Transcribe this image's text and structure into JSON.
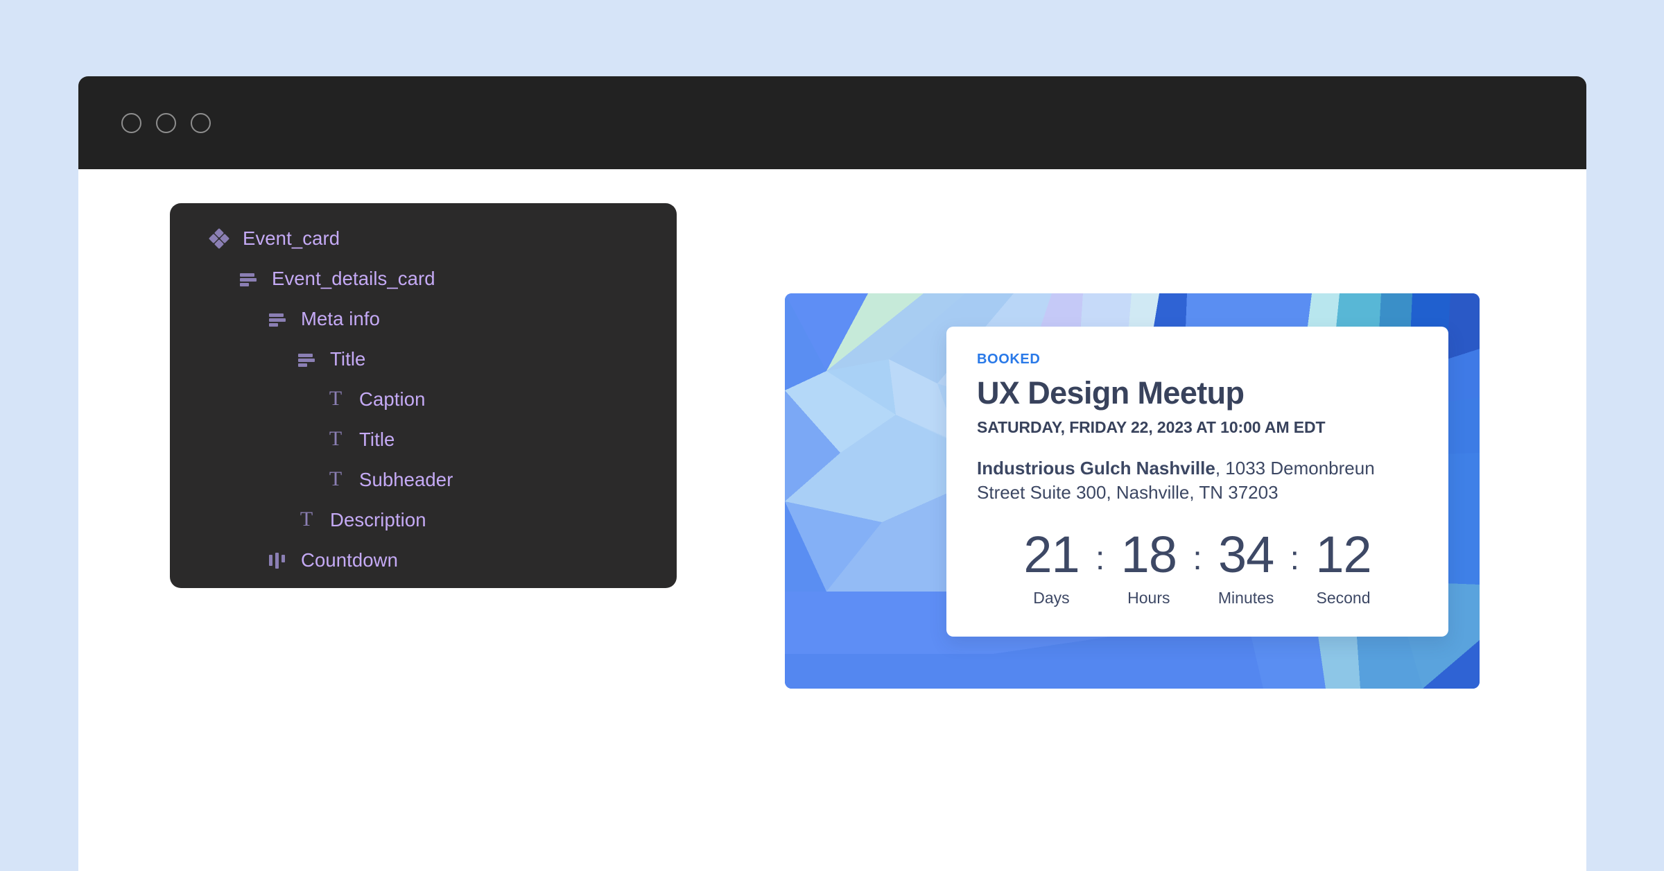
{
  "window": {
    "traffic_lights": [
      "close-dot",
      "minimize-dot",
      "maximize-dot"
    ]
  },
  "layer_tree": {
    "items": [
      {
        "label": "Event_card",
        "icon": "component-diamonds-icon",
        "depth": 0,
        "icon_type": "diamonds"
      },
      {
        "label": "Event_details_card",
        "icon": "text-lines-icon",
        "depth": 1,
        "icon_type": "lines"
      },
      {
        "label": "Meta info",
        "icon": "text-lines-icon",
        "depth": 2,
        "icon_type": "lines"
      },
      {
        "label": "Title",
        "icon": "text-lines-icon",
        "depth": 3,
        "icon_type": "lines"
      },
      {
        "label": "Caption",
        "icon": "text-element-icon",
        "depth": 4,
        "icon_type": "text"
      },
      {
        "label": "Title",
        "icon": "text-element-icon",
        "depth": 4,
        "icon_type": "text"
      },
      {
        "label": "Subheader",
        "icon": "text-element-icon",
        "depth": 4,
        "icon_type": "text"
      },
      {
        "label": "Description",
        "icon": "text-element-icon",
        "depth": 3,
        "icon_type": "text"
      },
      {
        "label": "Countdown",
        "icon": "countdown-bars-icon",
        "depth": 2,
        "icon_type": "bars"
      }
    ]
  },
  "event_card": {
    "badge": "BOOKED",
    "title": "UX Design Meetup",
    "datetime": "SATURDAY, FRIDAY 22, 2023 AT 10:00 AM EDT",
    "venue_name": "Industrious Gulch Nashville",
    "venue_address": ", 1033 Demonbreun Street Suite 300, Nashville, TN 37203",
    "countdown": {
      "separator": ":",
      "units": [
        {
          "value": "21",
          "label": "Days"
        },
        {
          "value": "18",
          "label": "Hours"
        },
        {
          "value": "34",
          "label": "Minutes"
        },
        {
          "value": "12",
          "label": "Second"
        }
      ]
    }
  },
  "colors": {
    "page_background": "#d6e4f8",
    "titlebar": "#222222",
    "panel_background": "#2b2a2a",
    "tree_label": "#c5aaf5",
    "tree_icon": "#8b7fb4",
    "badge_accent": "#2979e8",
    "text_dark": "#38425c",
    "card_background": "#ffffff"
  }
}
